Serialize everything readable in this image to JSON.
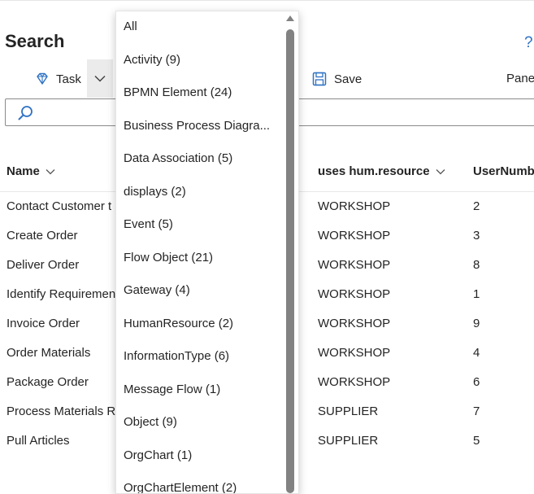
{
  "page": {
    "title": "Search",
    "help_glyph": "?"
  },
  "toolbar": {
    "task_label": "Task",
    "save_label": "Save",
    "panel_label": "Pane"
  },
  "search": {
    "value": "",
    "placeholder": ""
  },
  "table": {
    "columns": [
      "Name",
      "uses hum.resource",
      "UserNumb"
    ],
    "rows": [
      {
        "name": "Contact Customer t",
        "resource": "WORKSHOP",
        "number": "2"
      },
      {
        "name": "Create Order",
        "resource": "WORKSHOP",
        "number": "3"
      },
      {
        "name": "Deliver Order",
        "resource": "WORKSHOP",
        "number": "8"
      },
      {
        "name": "Identify Requiremen",
        "resource": "WORKSHOP",
        "number": "1"
      },
      {
        "name": "Invoice Order",
        "resource": "WORKSHOP",
        "number": "9"
      },
      {
        "name": "Order Materials",
        "resource": "WORKSHOP",
        "number": "4"
      },
      {
        "name": "Package Order",
        "resource": "WORKSHOP",
        "number": "6"
      },
      {
        "name": "Process Materials R",
        "resource": "SUPPLIER",
        "number": "7"
      },
      {
        "name": "Pull Articles",
        "resource": "SUPPLIER",
        "number": "5"
      }
    ]
  },
  "dropdown": {
    "items": [
      "All",
      "Activity (9)",
      "BPMN Element (24)",
      "Business Process Diagra...",
      "Data Association (5)",
      "displays (2)",
      "Event (5)",
      "Flow Object (21)",
      "Gateway (4)",
      "HumanResource (2)",
      "InformationType (6)",
      "Message Flow (1)",
      "Object (9)",
      "OrgChart (1)",
      "OrgChartElement (2)"
    ]
  },
  "colors": {
    "accent": "#2f72c4",
    "scrollbar": "#828282",
    "chevron_button_bg": "#ebebeb"
  },
  "icons": {
    "task": "diamond-icon",
    "save": "floppy-disk-icon",
    "search": "magnifier-icon",
    "sort": "chevron-down-icon"
  }
}
